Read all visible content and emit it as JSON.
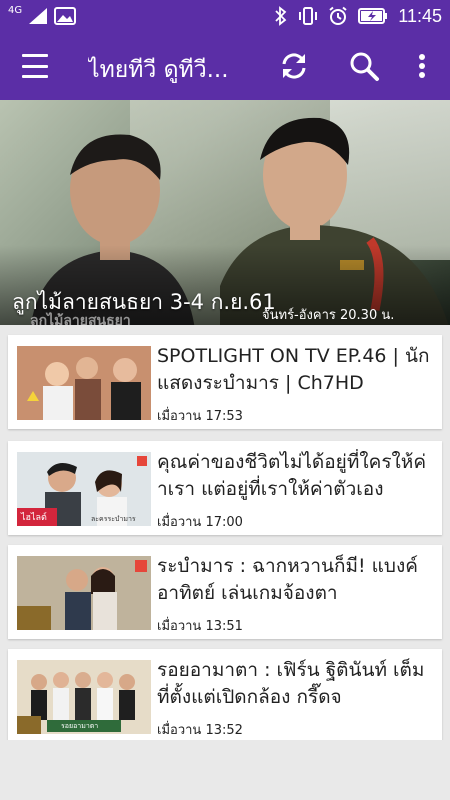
{
  "status_bar": {
    "network": "4G",
    "time": "11:45",
    "icons": [
      "signal-icon",
      "image-icon",
      "bluetooth-icon",
      "vibrate-icon",
      "alarm-icon",
      "battery-charging-icon"
    ]
  },
  "app_bar": {
    "title": "ไทยทีวี ดูทีวี...",
    "icons": [
      "menu-icon",
      "refresh-icon",
      "search-icon",
      "more-vert-icon"
    ],
    "colors": {
      "primary": "#5b2ea6",
      "text": "#ffffff"
    }
  },
  "hero": {
    "caption": "ลูกไม้ลายสนธยา 3-4 ก.ย.61",
    "watermark": "ลูกไม้ลายสนธยา",
    "schedule": "จันทร์-อังคาร 20.30 น."
  },
  "videos": [
    {
      "title": "SPOTLIGHT ON TV EP.46 | นักแสดงระบำมาร | Ch7HD",
      "time": "เมื่อวาน 17:53"
    },
    {
      "title": "คุณค่าของชีวิตไม่ได้อยู่ที่ใครให้ค่าเรา แต่อยู่ที่เราให้ค่าตัวเอง",
      "time": "เมื่อวาน 17:00"
    },
    {
      "title": "ระบำมาร : ฉากหวานก็มี! แบงค์ อาทิตย์ เล่นเกมจ้องตา",
      "time": "เมื่อวาน 13:51"
    },
    {
      "title": "รอยอามาตา : เฟิร์น ฐิตินันท์ เต็มที่ตั้งแต่เปิดกล้อง กรี๊ดจ",
      "time": "เมื่อวาน 13:52"
    }
  ],
  "thumb_labels": {
    "v2_badge": "ไฮไลต์",
    "v2_show": "ละครระบำมาร",
    "v4_banner": "รอยอามาตา"
  }
}
